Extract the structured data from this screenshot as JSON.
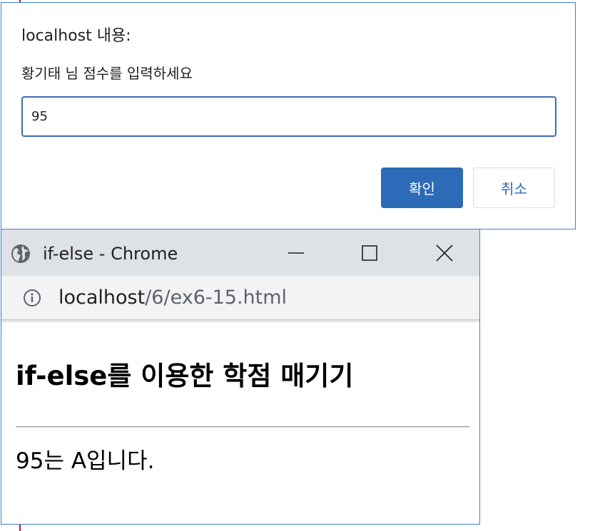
{
  "dialog": {
    "title": "localhost 내용:",
    "message": "황기태 님 점수를 입력하세요",
    "input_value": "95",
    "ok_label": "확인",
    "cancel_label": "취소",
    "accent_color": "#2d6ab8"
  },
  "browser": {
    "window_title": "if-else - Chrome",
    "url_host": "localhost",
    "url_path": "/6/ex6-15.html",
    "icons": {
      "site": "globe-icon",
      "address": "info-icon",
      "minimize": "minimize-icon",
      "maximize": "maximize-icon",
      "close": "close-icon"
    }
  },
  "page": {
    "heading": "if-else를 이용한 학점 매기기",
    "result": "95는 A입니다."
  }
}
